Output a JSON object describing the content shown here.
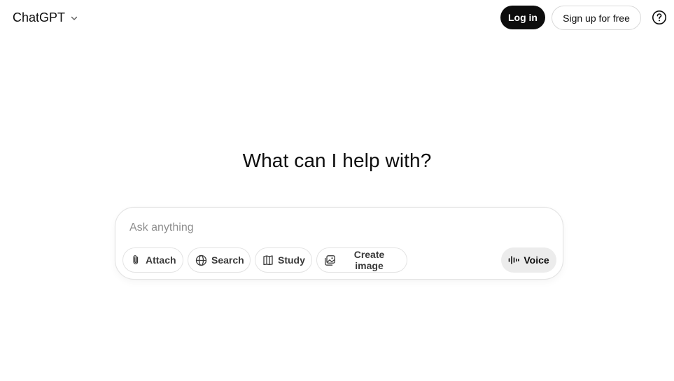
{
  "header": {
    "model_label": "ChatGPT",
    "model_chevron_icon": "chevron-down-icon",
    "login_label": "Log in",
    "signup_label": "Sign up for free",
    "help_icon": "question-circle-icon"
  },
  "main": {
    "headline": "What can I help with?"
  },
  "composer": {
    "placeholder": "Ask anything",
    "value": "",
    "tools": [
      {
        "label": "Attach",
        "icon": "paperclip-icon"
      },
      {
        "label": "Search",
        "icon": "globe-icon"
      },
      {
        "label": "Study",
        "icon": "book-icon"
      },
      {
        "label": "Create image",
        "icon": "image-icon"
      }
    ],
    "voice_label": "Voice",
    "voice_icon": "soundwave-icon"
  },
  "colors": {
    "primary_button_bg": "#0d0d0d",
    "primary_button_text": "#ffffff",
    "border": "#e3e3e3",
    "voice_bg": "#ececec",
    "placeholder": "#8f8f8f"
  }
}
